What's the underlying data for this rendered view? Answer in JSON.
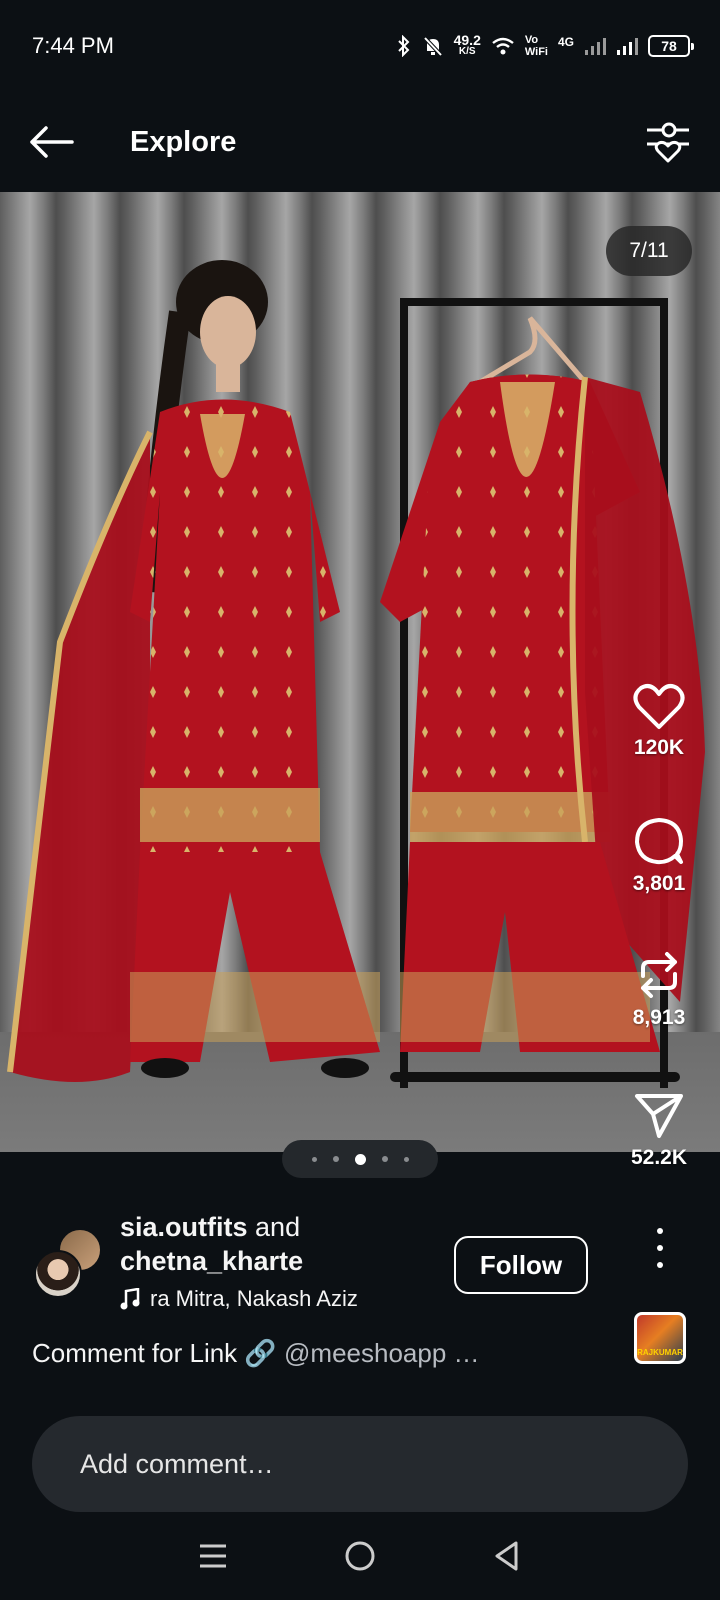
{
  "status_bar": {
    "time": "7:44 PM",
    "net_speed_value": "49.2",
    "net_speed_unit": "K/S",
    "vo_label": "Vo",
    "wifi_label": "WiFi",
    "network_type": "4G",
    "battery": "78"
  },
  "header": {
    "title": "Explore",
    "back_icon": "arrow-left-icon",
    "filter_icon": "sliders-heart-icon"
  },
  "media": {
    "counter": "7/11",
    "carousel_dots": 5,
    "active_dot": 2,
    "description_colors": {
      "garment": "#b3121f",
      "embroidery": "#d8b46a",
      "backdrop": "#8a8a8a"
    }
  },
  "actions": {
    "likes": "120K",
    "comments": "3,801",
    "reposts": "8,913",
    "shares": "52.2K"
  },
  "post": {
    "author_1": "sia.outfits",
    "joiner": "and",
    "author_2": "chetna_kharte",
    "audio": "ra Mitra, Nakash Aziz",
    "follow_label": "Follow",
    "caption_text": "Comment for Link",
    "caption_link_icon": "🔗",
    "caption_mention": "@meeshoapp …",
    "music_thumb_text": "RAJKUMAR"
  },
  "comment": {
    "placeholder": "Add comment…"
  },
  "colors": {
    "background": "#0c1014",
    "input_bg": "#25292e",
    "accent_white": "#ffffff"
  }
}
